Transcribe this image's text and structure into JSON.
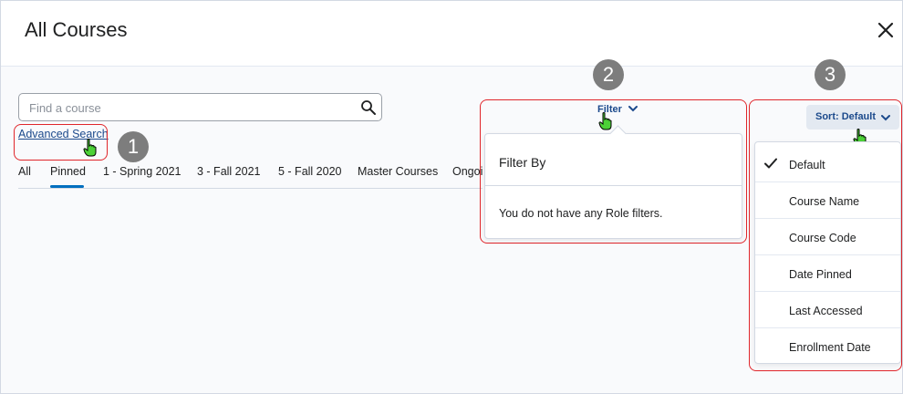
{
  "header": {
    "title": "All Courses"
  },
  "search": {
    "placeholder": "Find a course",
    "value": ""
  },
  "advanced_search": {
    "label": "Advanced Search"
  },
  "tabs": [
    {
      "label": "All"
    },
    {
      "label": "Pinned",
      "active": true
    },
    {
      "label": "1 - Spring 2021"
    },
    {
      "label": "3 - Fall 2021"
    },
    {
      "label": "5 - Fall 2020"
    },
    {
      "label": "Master Courses"
    },
    {
      "label": "Ongoi"
    }
  ],
  "filter": {
    "button_label": "Filter",
    "panel_title": "Filter By",
    "empty_message": "You do not have any Role filters."
  },
  "sort": {
    "button_label": "Sort: Default",
    "options": [
      {
        "label": "Default",
        "selected": true
      },
      {
        "label": "Course Name"
      },
      {
        "label": "Course Code"
      },
      {
        "label": "Date Pinned"
      },
      {
        "label": "Last Accessed"
      },
      {
        "label": "Enrollment Date"
      }
    ]
  },
  "callouts": {
    "one": "1",
    "two": "2",
    "three": "3"
  },
  "colors": {
    "link": "#1c4a8c",
    "accent": "#006fbf",
    "callout": "#e0262b",
    "badge": "#7d7d7d"
  },
  "icons": [
    "close-icon",
    "search-icon",
    "chevron-down-icon",
    "checkmark-icon",
    "hand-cursor-icon"
  ]
}
